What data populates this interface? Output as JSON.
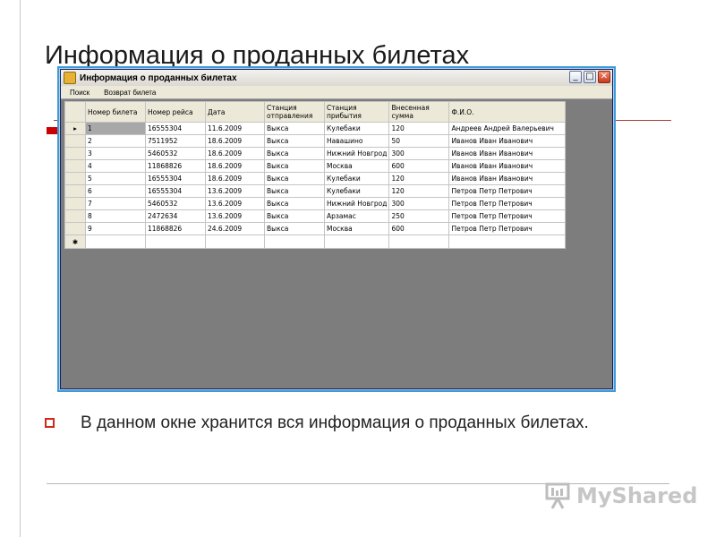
{
  "slide": {
    "title": "Информация о проданных билетах",
    "bullet": "В данном окне хранится вся информация о проданных билетах."
  },
  "window": {
    "title": "Информация о проданных билетах",
    "menu": [
      "Поиск",
      "Возврат билета"
    ],
    "buttons": {
      "minimize": "_",
      "maximize": "□",
      "close": "✕"
    }
  },
  "grid": {
    "columns": [
      "Номер билета",
      "Номер рейса",
      "Дата",
      "Станция отправления",
      "Станция прибытия",
      "Внесенная сумма",
      "Ф.И.О."
    ],
    "rows": [
      [
        "1",
        "16555304",
        "11.6.2009",
        "Выкса",
        "Кулебаки",
        "120",
        "Андреев Андрей Валерьевич"
      ],
      [
        "2",
        "7511952",
        "18.6.2009",
        "Выкса",
        "Навашино",
        "50",
        "Иванов Иван Иванович"
      ],
      [
        "3",
        "5460532",
        "18.6.2009",
        "Выкса",
        "Нижний Новгрод",
        "300",
        "Иванов Иван Иванович"
      ],
      [
        "4",
        "11868826",
        "18.6.2009",
        "Выкса",
        "Москва",
        "600",
        "Иванов Иван Иванович"
      ],
      [
        "5",
        "16555304",
        "18.6.2009",
        "Выкса",
        "Кулебаки",
        "120",
        "Иванов Иван Иванович"
      ],
      [
        "6",
        "16555304",
        "13.6.2009",
        "Выкса",
        "Кулебаки",
        "120",
        "Петров Петр Петрович"
      ],
      [
        "7",
        "5460532",
        "13.6.2009",
        "Выкса",
        "Нижний Новгрод",
        "300",
        "Петров Петр Петрович"
      ],
      [
        "8",
        "2472634",
        "13.6.2009",
        "Выкса",
        "Арзамас",
        "250",
        "Петров Петр Петрович"
      ],
      [
        "9",
        "11868826",
        "24.6.2009",
        "Выкса",
        "Москва",
        "600",
        "Петров Петр Петрович"
      ]
    ],
    "current_row_marker": "▸",
    "new_row_marker": "✱"
  },
  "watermark": {
    "text": "MyShared",
    "icon": "presentation-board-icon"
  },
  "colors": {
    "accent": "#cc0000",
    "window_border": "#3c9bd6",
    "client_bg": "#7d7d7d"
  }
}
